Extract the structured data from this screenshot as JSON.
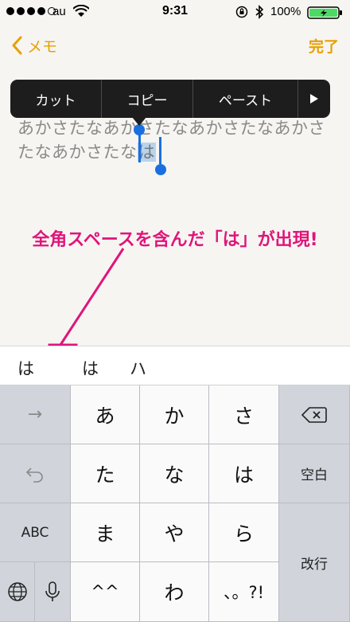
{
  "status_bar": {
    "carrier": "au",
    "time": "9:31",
    "battery_percent": "100%",
    "signal_bars_filled": 4,
    "signal_bars_total": 5,
    "battery_level": 1.0,
    "charging_color": "#4cd964"
  },
  "nav": {
    "back_label": "メモ",
    "done_label": "完了",
    "accent_color": "#e8a000"
  },
  "note": {
    "line1": "あかさたなあかさたなあかさたなあかさ",
    "line2_prefix": "たなあかさたな",
    "line2_selected": "は"
  },
  "context_menu": {
    "items": [
      "カット",
      "コピー",
      "ペースト"
    ],
    "more_icon": "triangle-right-icon"
  },
  "annotation": {
    "text": "全角スペースを含んだ「は」が出現!",
    "color": "#e0157a"
  },
  "candidates": [
    "は",
    "は",
    "ハ"
  ],
  "keyboard": {
    "left_column": {
      "next": "→",
      "undo_icon": "undo-icon",
      "abc": "ABC",
      "globe_icon": "globe-icon",
      "mic_icon": "microphone-icon"
    },
    "keys": [
      [
        "あ",
        "か",
        "さ"
      ],
      [
        "た",
        "な",
        "は"
      ],
      [
        "ま",
        "や",
        "ら"
      ],
      [
        "^^",
        "わ",
        "、。?!"
      ]
    ],
    "right_column": {
      "delete_icon": "backspace-icon",
      "space": "空白",
      "return": "改行"
    }
  }
}
